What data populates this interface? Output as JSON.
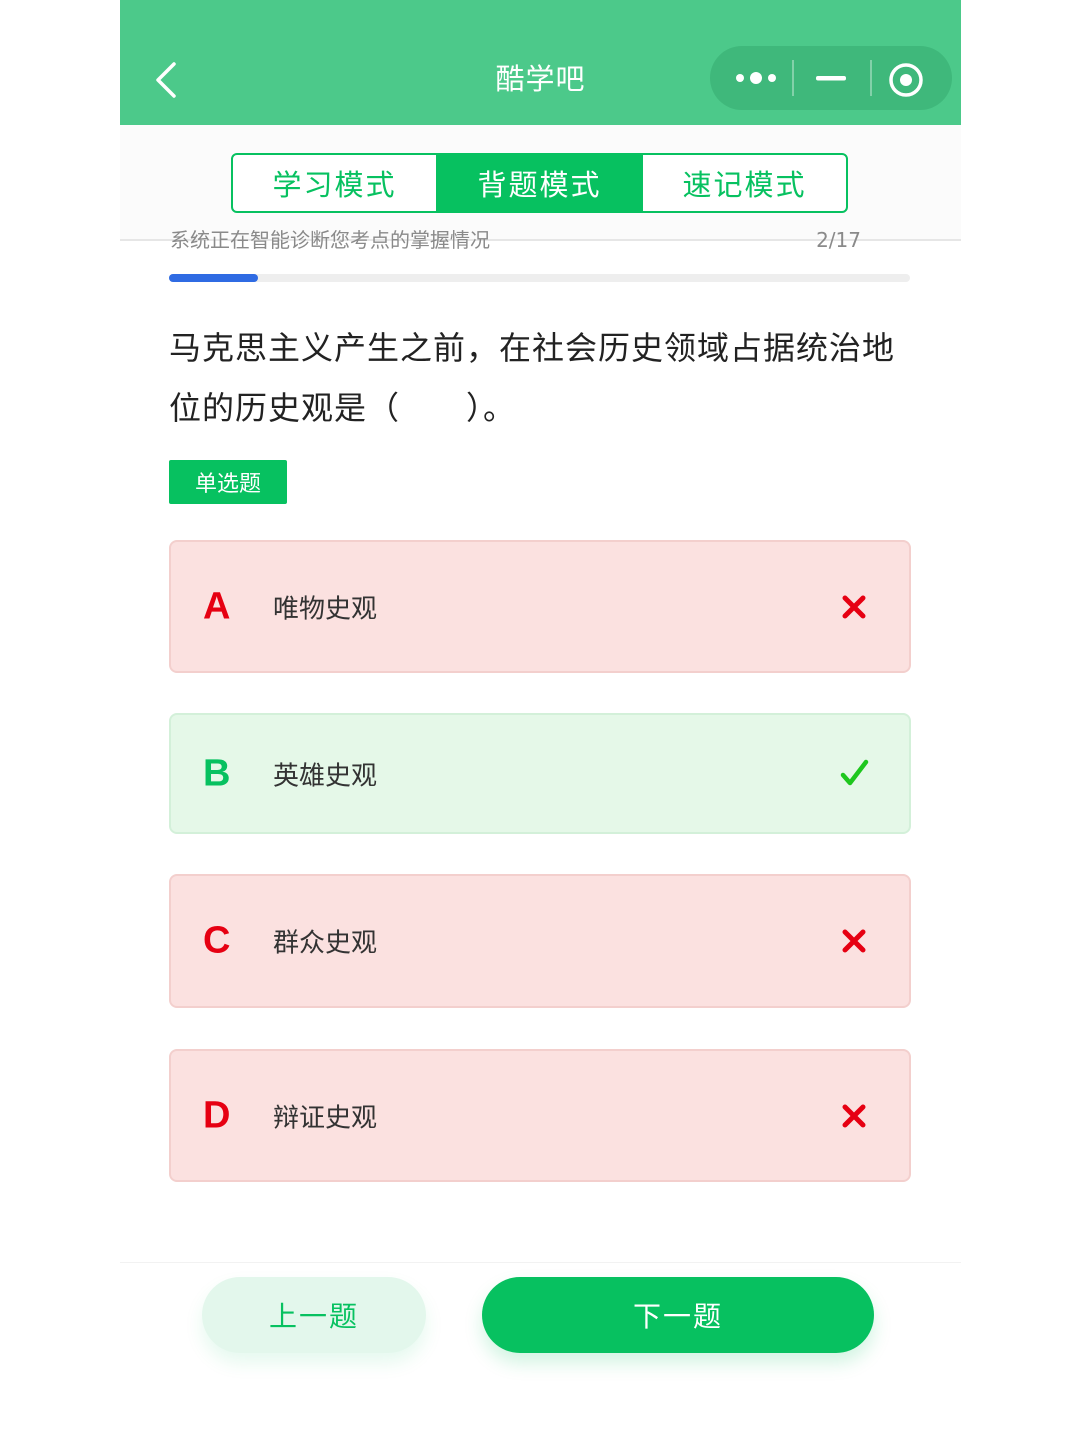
{
  "header": {
    "title": "酷学吧"
  },
  "modes": {
    "tabs": [
      {
        "label": "学习模式",
        "active": false
      },
      {
        "label": "背题模式",
        "active": true
      },
      {
        "label": "速记模式",
        "active": false
      }
    ]
  },
  "progress": {
    "text": "系统正在智能诊断您考点的掌握情况",
    "count": "2/17",
    "fraction": 0.12
  },
  "question": {
    "text": "马克思主义产生之前，在社会历史领域占据统治地位的历史观是（　　）。",
    "type_label": "单选题"
  },
  "options": [
    {
      "letter": "A",
      "text": "唯物史观",
      "status": "wrong",
      "mark": "cross-icon"
    },
    {
      "letter": "B",
      "text": "英雄史观",
      "status": "right",
      "mark": "check-icon"
    },
    {
      "letter": "C",
      "text": "群众史观",
      "status": "wrong",
      "mark": "cross-icon"
    },
    {
      "letter": "D",
      "text": "辩证史观",
      "status": "wrong",
      "mark": "cross-icon"
    }
  ],
  "nav": {
    "prev_label": "上一题",
    "next_label": "下一题"
  },
  "colors": {
    "header": "#4cc98a",
    "accent": "#07c160",
    "wrong": "#e60012",
    "progress": "#2f6be3"
  }
}
